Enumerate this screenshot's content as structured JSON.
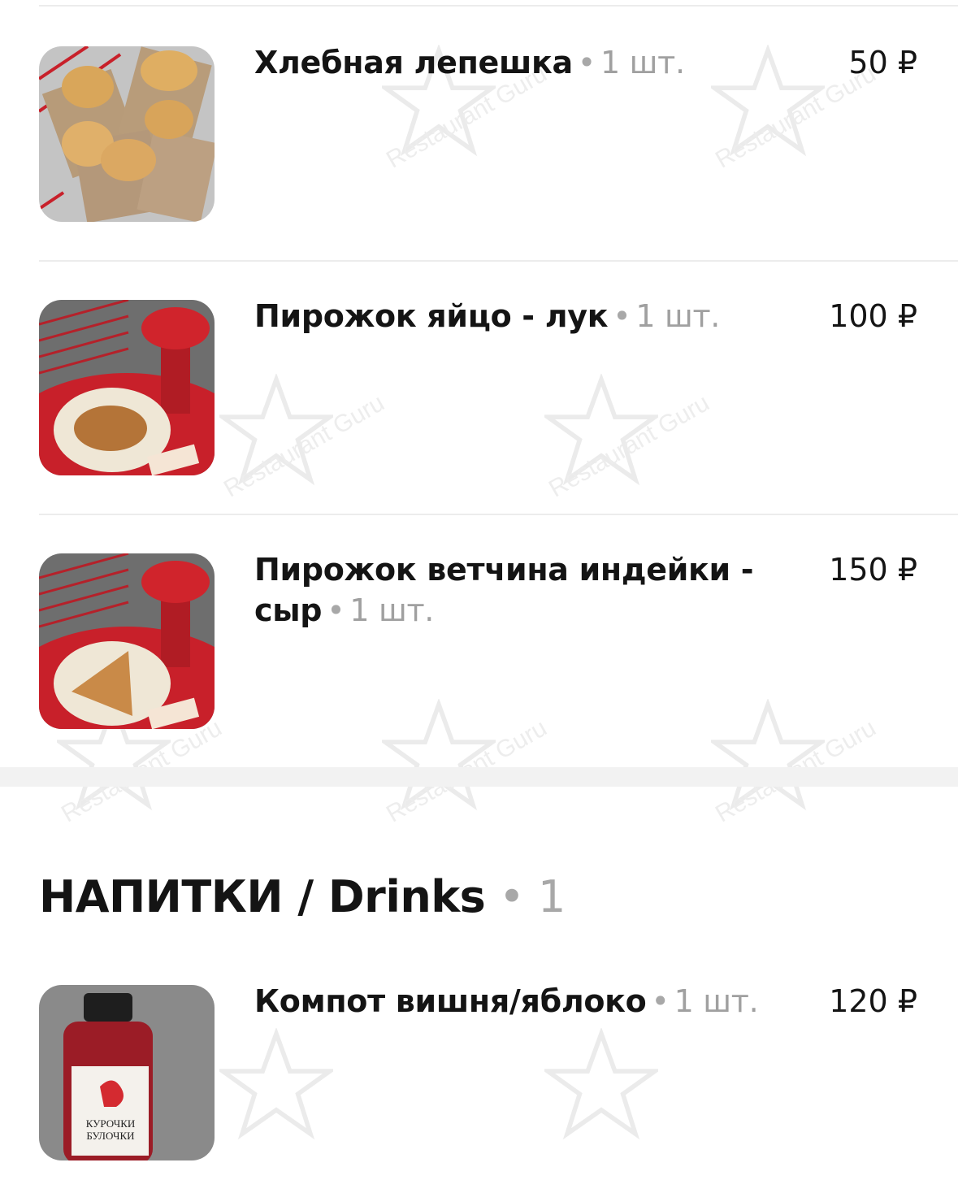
{
  "watermark": {
    "text": "Restaurant Guru",
    "icon": "fork-star-logo"
  },
  "items_section1": [
    {
      "name": "Хлебная лепешка",
      "qty": "1 шт.",
      "price": "50 ₽",
      "image": "flatbread-photo"
    },
    {
      "name": "Пирожок яйцо - лук",
      "qty": "1 шт.",
      "price": "100 ₽",
      "image": "pie-on-plate-photo"
    },
    {
      "name": "Пирожок ветчина индейки - сыр",
      "qty": "1 шт.",
      "price": "150 ₽",
      "image": "pie-on-plate-photo"
    }
  ],
  "section": {
    "title": "НАПИТКИ / Drinks",
    "count": "1"
  },
  "items_section2": [
    {
      "name": "Компот вишня/яблоко",
      "qty": "1 шт.",
      "price": "120 ₽",
      "image": "bottle-photo"
    }
  ],
  "colors": {
    "accent_red": "#c8202a",
    "qty_gray": "#a0a0a0",
    "divider": "#ececec"
  }
}
